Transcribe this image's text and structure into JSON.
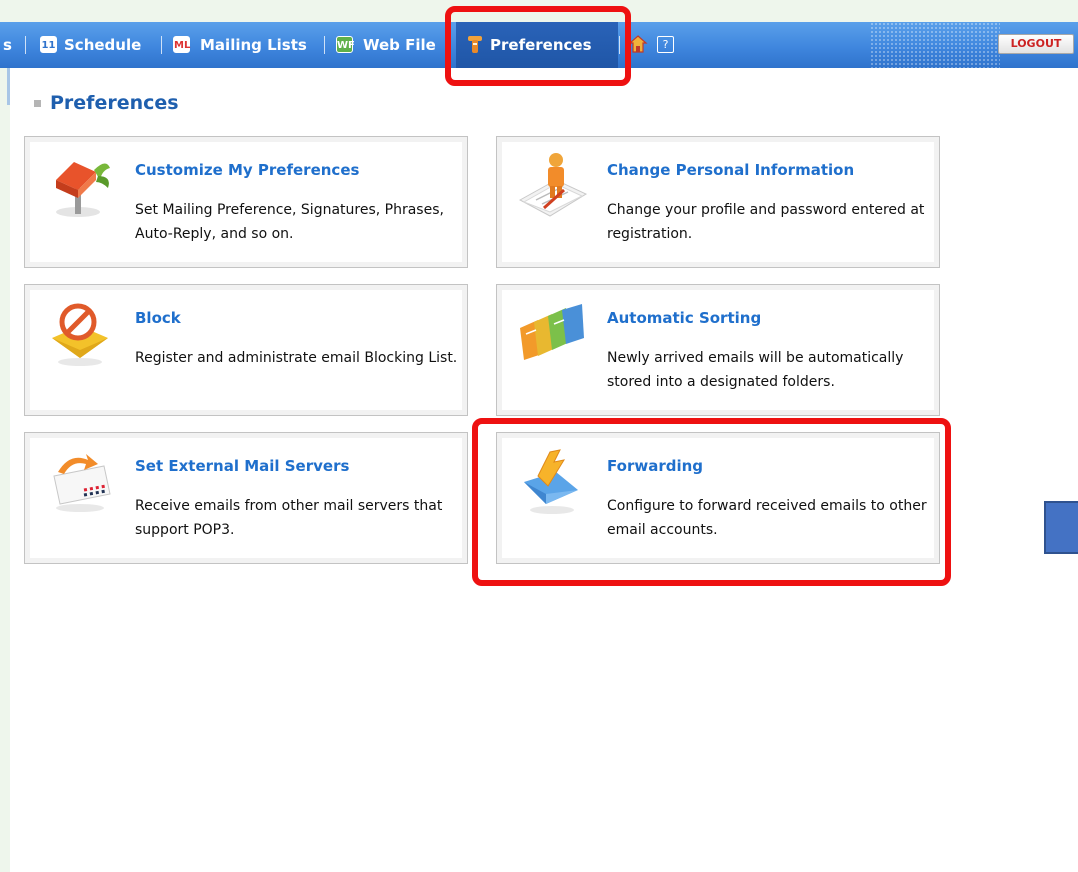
{
  "nav": {
    "partial_item": "s",
    "items": [
      {
        "label": "Schedule",
        "icon": "calendar-icon"
      },
      {
        "label": "Mailing Lists",
        "icon": "mailing-list-icon"
      },
      {
        "label": "Web File",
        "icon": "web-file-icon"
      },
      {
        "label": "Preferences",
        "icon": "wrench-icon",
        "selected": true
      }
    ],
    "logout_label": "LOGOUT",
    "help_label": "?",
    "calendar_glyph": "11",
    "mailing_glyph": "ML",
    "webfile_glyph": "WF"
  },
  "page": {
    "title": "Preferences"
  },
  "cards": [
    {
      "title": "Customize My Preferences",
      "desc": "Set Mailing Preference, Signatures, Phrases, Auto-Reply, and so on.",
      "icon": "mailbox-icon"
    },
    {
      "title": "Change Personal Information",
      "desc": "Change your profile and password entered at registration.",
      "icon": "person-profile-icon"
    },
    {
      "title": "Block",
      "desc": "Register and administrate email Blocking List.",
      "icon": "block-mail-icon"
    },
    {
      "title": "Automatic Sorting",
      "desc": "Newly arrived emails will be automatically stored into a designated folders.",
      "icon": "folders-icon"
    },
    {
      "title": "Set External Mail Servers",
      "desc": "Receive emails from other mail servers that support POP3.",
      "icon": "external-mail-icon"
    },
    {
      "title": "Forwarding",
      "desc": "Configure to forward received emails to other email accounts.",
      "icon": "forward-mail-icon"
    }
  ],
  "colors": {
    "nav_bg": "#3f86de",
    "selected_bg": "#1f56a7",
    "title": "#1f5fae",
    "card_title": "#1f6fcc",
    "highlight": "#ee1111"
  }
}
